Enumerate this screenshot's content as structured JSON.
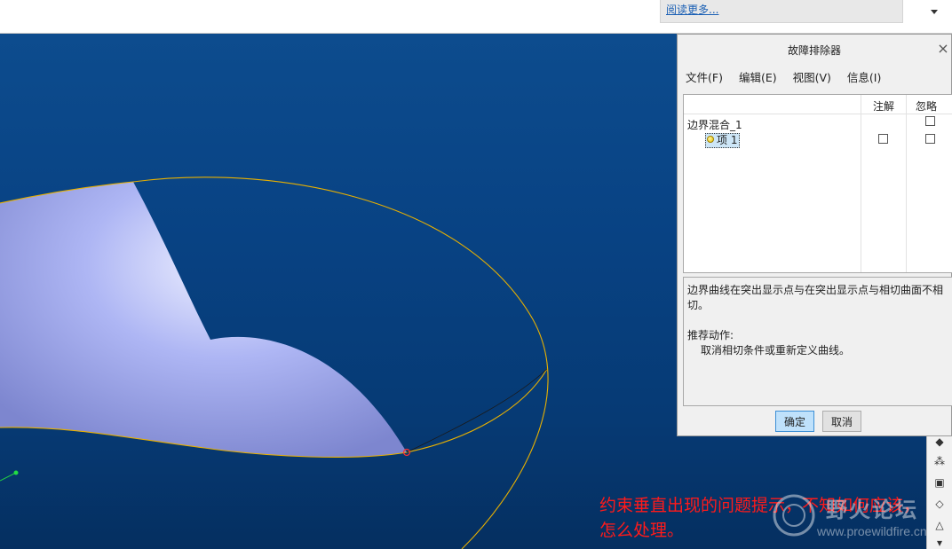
{
  "topbar": {
    "read_more_link": "阅读更多..."
  },
  "dialog": {
    "title": "故障排除器",
    "close_glyph": "×",
    "menu": [
      "文件(F)",
      "编辑(E)",
      "视图(V)",
      "信息(I)"
    ],
    "columns": {
      "annotate": "注解",
      "ignore": "忽略"
    },
    "tree": {
      "parent_label": "边界混合_1",
      "child_label": "项 1",
      "parent_ignore_checked": false,
      "child_annotate_checked": false,
      "child_ignore_checked": false
    },
    "description": {
      "message": "边界曲线在突出显示点与在突出显示点与相切曲面不相切。",
      "recommended_heading": "推荐动作:",
      "recommended_action": "取消相切条件或重新定义曲线。"
    },
    "buttons": {
      "ok": "确定",
      "cancel": "取消"
    }
  },
  "viewport": {
    "surface_color": "#a9b2f2",
    "curve_color": "#e8b000",
    "background_color": "#0b4584"
  },
  "caption": {
    "line1": "约束垂直出现的问题提示，不知如何应该，",
    "line2": "怎么处理。"
  },
  "watermark": {
    "name": "野火论坛",
    "url": "www.proewildfire.cn"
  }
}
